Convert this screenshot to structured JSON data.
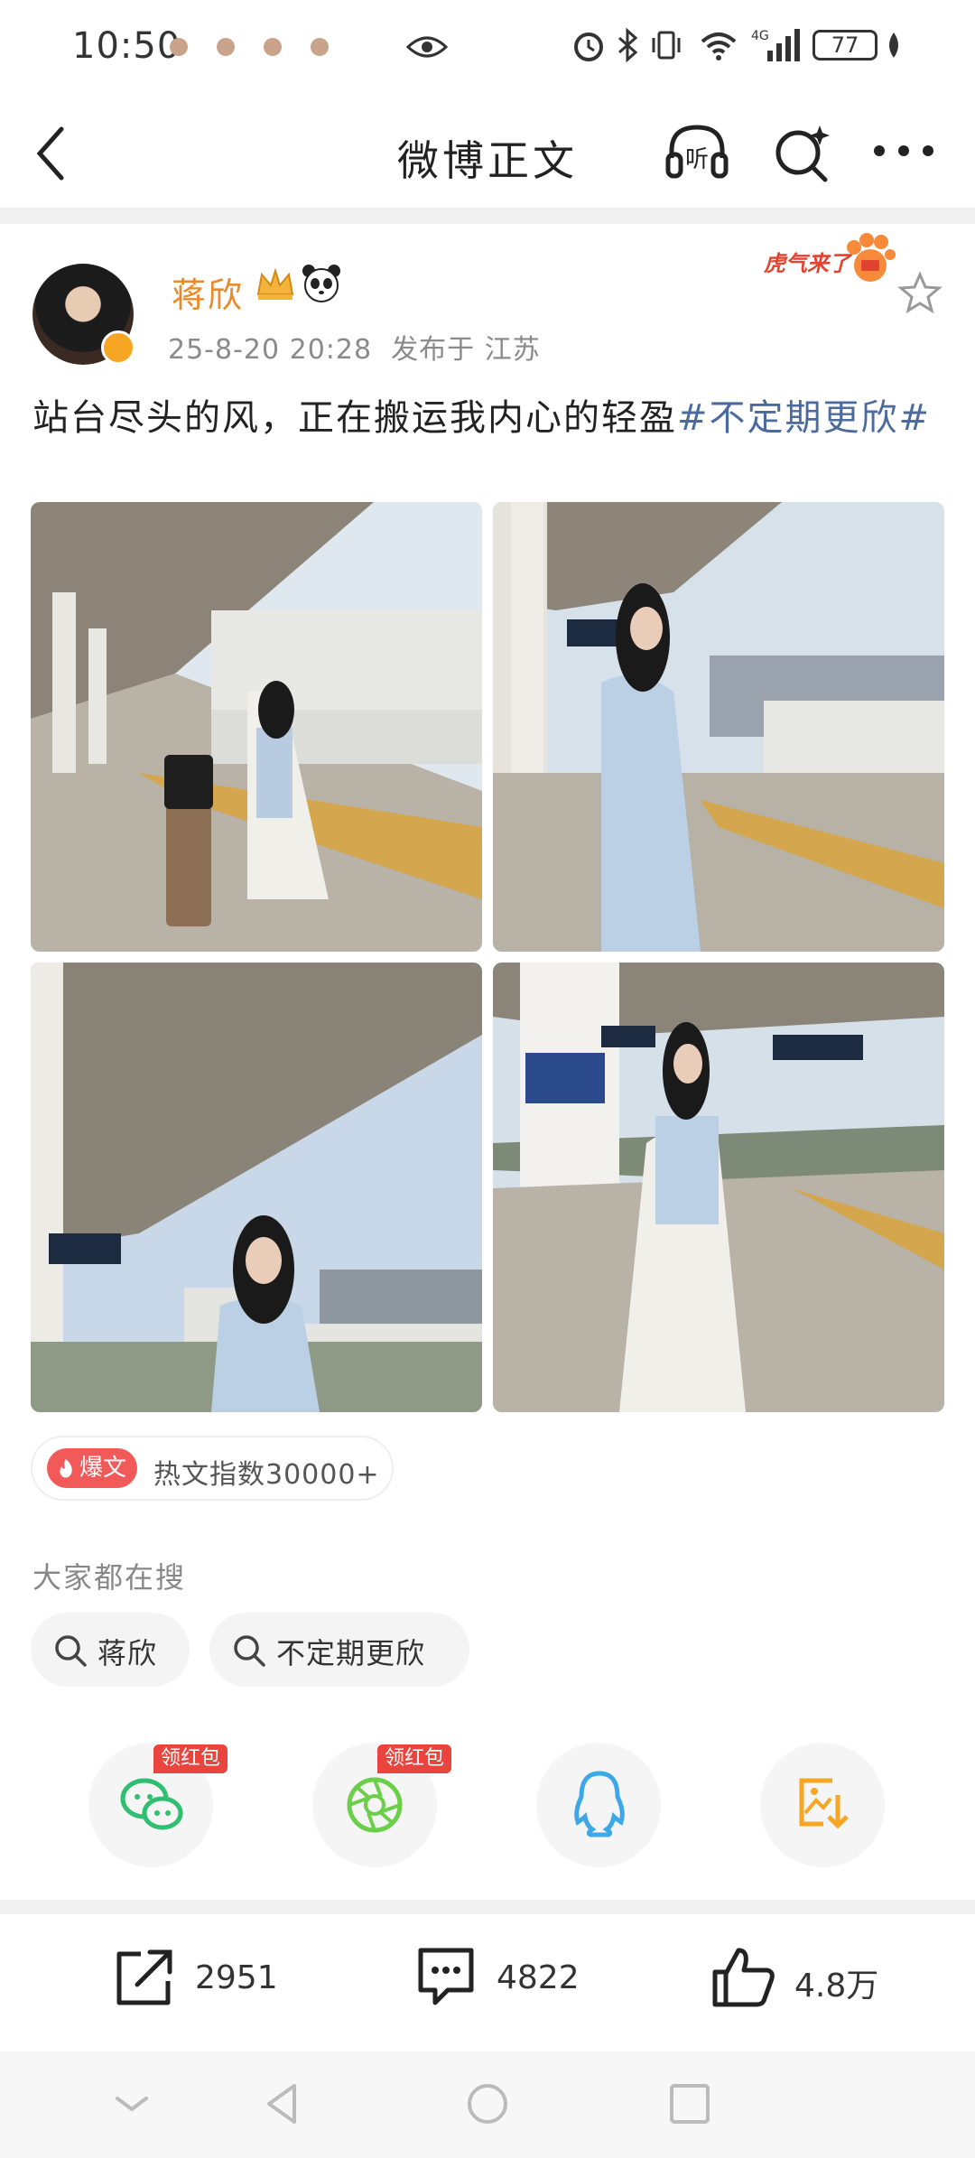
{
  "status_bar": {
    "time": "10:50",
    "battery": "77"
  },
  "header": {
    "title": "微博正文"
  },
  "post": {
    "author": "蒋欣",
    "timestamp": "25-8-20 20:28",
    "location": "发布于 江苏",
    "text": "站台尽头的风，正在搬运我内心的轻盈",
    "hashtag": "#不定期更欣#",
    "badge_text": "虎气来了"
  },
  "hot": {
    "tag": "爆文",
    "text": "热文指数30000+"
  },
  "searches": {
    "heading": "大家都在搜",
    "items": [
      "蒋欣",
      "不定期更欣"
    ]
  },
  "share": {
    "items": [
      {
        "icon": "wechat-icon",
        "badge": "领红包",
        "color": "#2fbf71"
      },
      {
        "icon": "moments-icon",
        "badge": "领红包",
        "color": "#6ccf4a"
      },
      {
        "icon": "qq-icon",
        "badge": "",
        "color": "#3ea7e8"
      },
      {
        "icon": "save-image-icon",
        "badge": "",
        "color": "#f5a623"
      }
    ]
  },
  "actions": {
    "repost": "2951",
    "comment": "4822",
    "like": "4.8万"
  },
  "colors": {
    "author": "#e88a2b",
    "hashtag": "#4b6a9e",
    "hot_tag": "#f25a5a",
    "hongbao": "#e9443d"
  }
}
